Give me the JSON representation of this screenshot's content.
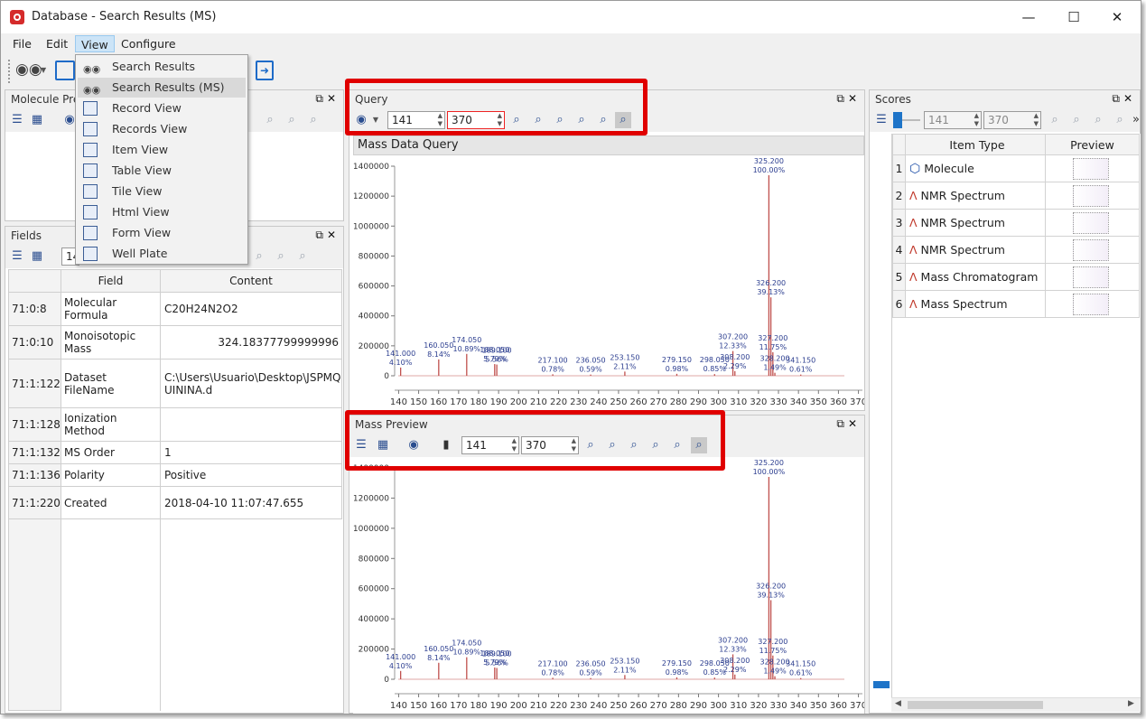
{
  "window": {
    "title": "Database - Search Results (MS)"
  },
  "menu": {
    "file": "File",
    "edit": "Edit",
    "view": "View",
    "configure": "Configure"
  },
  "view_menu": {
    "items": [
      "Search Results",
      "Search Results (MS)",
      "Record View",
      "Records View",
      "Item View",
      "Table View",
      "Tile View",
      "Html View",
      "Form View",
      "Well Plate"
    ],
    "selected": "Search Results (MS)"
  },
  "molecule_preview": {
    "title": "Molecule Prev"
  },
  "fields": {
    "title": "Fields",
    "spin_value": "14",
    "headers": {
      "field": "Field",
      "content": "Content"
    },
    "rows": [
      {
        "id": "71:0:8",
        "field": "Molecular Formula",
        "content": "C20H24N2O2"
      },
      {
        "id": "71:0:10",
        "field": "Monoisotopic Mass",
        "content": "324.18377799999996"
      },
      {
        "id": "71:1:122",
        "field": "Dataset FileName",
        "content": "C:\\Users\\Usuario\\Desktop\\JSPMQUININA.d"
      },
      {
        "id": "71:1:128",
        "field": "Ionization Method",
        "content": ""
      },
      {
        "id": "71:1:132",
        "field": "MS Order",
        "content": "1"
      },
      {
        "id": "71:1:136",
        "field": "Polarity",
        "content": "Positive"
      },
      {
        "id": "71:1:220",
        "field": "Created",
        "content": "2018-04-10 11:07:47.655"
      }
    ]
  },
  "query": {
    "title": "Query",
    "from": "141",
    "to": "370",
    "tab": "Mass Data Query"
  },
  "mass_preview": {
    "title": "Mass Preview",
    "from": "141",
    "to": "370"
  },
  "scores": {
    "title": "Scores",
    "from": "141",
    "to": "370",
    "headers": {
      "item_type": "Item Type",
      "preview": "Preview"
    },
    "rows": [
      {
        "index": "1",
        "type": "Molecule",
        "icon": "molecule-icon"
      },
      {
        "index": "2",
        "type": "NMR Spectrum",
        "icon": "spectrum-icon"
      },
      {
        "index": "3",
        "type": "NMR Spectrum",
        "icon": "spectrum-icon"
      },
      {
        "index": "4",
        "type": "NMR Spectrum",
        "icon": "spectrum-icon"
      },
      {
        "index": "5",
        "type": "Mass Chromatogram",
        "icon": "spectrum-icon"
      },
      {
        "index": "6",
        "type": "Mass Spectrum",
        "icon": "spectrum-icon"
      }
    ]
  },
  "colors": {
    "peak": "#c0504d",
    "label": "#2b3d8f",
    "highlight": "#e00000",
    "accent": "#1e74c8"
  },
  "chart_data": [
    {
      "type": "bar",
      "name": "query-spectrum",
      "xlim": [
        138,
        372
      ],
      "ylim": [
        0,
        1400000
      ],
      "xticks": [
        140,
        150,
        160,
        170,
        180,
        190,
        200,
        210,
        220,
        230,
        240,
        250,
        260,
        270,
        280,
        290,
        300,
        310,
        320,
        330,
        340,
        350,
        360,
        370
      ],
      "yticks": [
        0,
        200000,
        400000,
        600000,
        800000,
        1000000,
        1200000,
        1400000
      ],
      "peaks": [
        {
          "mz": 141.0,
          "intensity": 55000,
          "label": "141.000",
          "pct": "4.10%"
        },
        {
          "mz": 160.05,
          "intensity": 109000,
          "label": "160.050",
          "pct": "8.14%"
        },
        {
          "mz": 174.05,
          "intensity": 146000,
          "label": "174.050",
          "pct": "10.89%"
        },
        {
          "mz": 188.05,
          "intensity": 78000,
          "label": "188.050",
          "pct": "5.79%"
        },
        {
          "mz": 189.1,
          "intensity": 75000,
          "label": "189.100",
          "pct": "5.56%"
        },
        {
          "mz": 217.1,
          "intensity": 10000,
          "label": "217.100",
          "pct": "0.78%"
        },
        {
          "mz": 236.05,
          "intensity": 8000,
          "label": "236.050",
          "pct": "0.59%"
        },
        {
          "mz": 253.15,
          "intensity": 28000,
          "label": "253.150",
          "pct": "2.11%"
        },
        {
          "mz": 279.15,
          "intensity": 13000,
          "label": "279.150",
          "pct": "0.98%"
        },
        {
          "mz": 298.05,
          "intensity": 11000,
          "label": "298.050",
          "pct": "0.85%"
        },
        {
          "mz": 307.2,
          "intensity": 165000,
          "label": "307.200",
          "pct": "12.33%"
        },
        {
          "mz": 308.2,
          "intensity": 31000,
          "label": "308.200",
          "pct": "2.29%"
        },
        {
          "mz": 325.2,
          "intensity": 1340000,
          "label": "325.200",
          "pct": "100.00%"
        },
        {
          "mz": 326.2,
          "intensity": 524000,
          "label": "326.200",
          "pct": "39.13%"
        },
        {
          "mz": 327.2,
          "intensity": 157000,
          "label": "327.200",
          "pct": "11.75%"
        },
        {
          "mz": 328.2,
          "intensity": 20000,
          "label": "328.200",
          "pct": "1.49%"
        },
        {
          "mz": 341.15,
          "intensity": 8000,
          "label": "341.150",
          "pct": "0.61%"
        }
      ]
    },
    {
      "type": "bar",
      "name": "mass-preview-spectrum",
      "xlim": [
        138,
        372
      ],
      "ylim": [
        0,
        1400000
      ],
      "xticks": [
        140,
        150,
        160,
        170,
        180,
        190,
        200,
        210,
        220,
        230,
        240,
        250,
        260,
        270,
        280,
        290,
        300,
        310,
        320,
        330,
        340,
        350,
        360,
        370
      ],
      "yticks": [
        0,
        200000,
        400000,
        600000,
        800000,
        1000000,
        1200000,
        1400000
      ],
      "peaks": [
        {
          "mz": 141.0,
          "intensity": 55000,
          "label": "141.000",
          "pct": "4.10%"
        },
        {
          "mz": 160.05,
          "intensity": 109000,
          "label": "160.050",
          "pct": "8.14%"
        },
        {
          "mz": 174.05,
          "intensity": 146000,
          "label": "174.050",
          "pct": "10.89%"
        },
        {
          "mz": 188.05,
          "intensity": 78000,
          "label": "188.050",
          "pct": "5.79%"
        },
        {
          "mz": 189.1,
          "intensity": 75000,
          "label": "189.100",
          "pct": "5.56%"
        },
        {
          "mz": 217.1,
          "intensity": 10000,
          "label": "217.100",
          "pct": "0.78%"
        },
        {
          "mz": 236.05,
          "intensity": 8000,
          "label": "236.050",
          "pct": "0.59%"
        },
        {
          "mz": 253.15,
          "intensity": 28000,
          "label": "253.150",
          "pct": "2.11%"
        },
        {
          "mz": 279.15,
          "intensity": 13000,
          "label": "279.150",
          "pct": "0.98%"
        },
        {
          "mz": 298.05,
          "intensity": 11000,
          "label": "298.050",
          "pct": "0.85%"
        },
        {
          "mz": 307.2,
          "intensity": 165000,
          "label": "307.200",
          "pct": "12.33%"
        },
        {
          "mz": 308.2,
          "intensity": 31000,
          "label": "308.200",
          "pct": "2.29%"
        },
        {
          "mz": 325.2,
          "intensity": 1340000,
          "label": "325.200",
          "pct": "100.00%"
        },
        {
          "mz": 326.2,
          "intensity": 524000,
          "label": "326.200",
          "pct": "39.13%"
        },
        {
          "mz": 327.2,
          "intensity": 157000,
          "label": "327.200",
          "pct": "11.75%"
        },
        {
          "mz": 328.2,
          "intensity": 20000,
          "label": "328.200",
          "pct": "1.49%"
        },
        {
          "mz": 341.15,
          "intensity": 8000,
          "label": "341.150",
          "pct": "0.61%"
        }
      ]
    }
  ]
}
